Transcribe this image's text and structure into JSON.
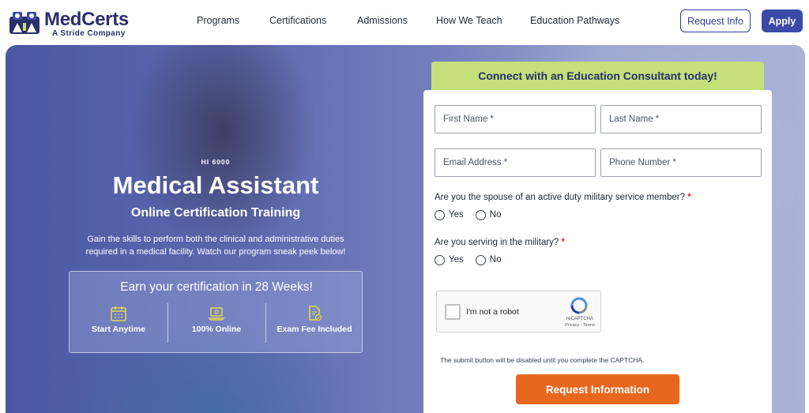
{
  "brand": {
    "name": "MedCerts",
    "tagline": "A Stride Company"
  },
  "nav": [
    {
      "label": "Programs"
    },
    {
      "label": "Certifications"
    },
    {
      "label": "Admissions"
    },
    {
      "label": "How We Teach"
    },
    {
      "label": "Education Pathways"
    }
  ],
  "header_actions": {
    "request_info": "Request Info",
    "apply": "Apply"
  },
  "hero": {
    "code": "HI 6000",
    "title": "Medical Assistant",
    "subtitle": "Online Certification Training",
    "description": "Gain the skills to perform both the clinical and administrative duties required in a medical facility. Watch our program sneak peek below!",
    "earn_title": "Earn your certification in 28 Weeks!",
    "features": [
      {
        "icon": "calendar-icon",
        "label": "Start Anytime"
      },
      {
        "icon": "laptop-icon",
        "label": "100% Online"
      },
      {
        "icon": "document-check-icon",
        "label": "Exam Fee Included"
      }
    ]
  },
  "form": {
    "banner": "Connect with an Education Consultant today!",
    "fields": {
      "first_name": "First Name *",
      "last_name": "Last Name *",
      "email": "Email Address *",
      "phone": "Phone Number *"
    },
    "q1": "Are you the spouse of an active duty military service member?",
    "q2": "Are you serving in the military?",
    "required_mark": "*",
    "yes": "Yes",
    "no": "No",
    "captcha": {
      "label": "I'm not a robot",
      "brand": "reCAPTCHA",
      "links": "Privacy - Terms"
    },
    "note": "The submit button will be disabled until you complete the CAPTCHA.",
    "submit": "Request Information"
  },
  "colors": {
    "brand_navy": "#2b2f6b",
    "primary": "#3b4aa8",
    "banner_green": "#c5df7a",
    "cta_orange": "#e8671f"
  }
}
